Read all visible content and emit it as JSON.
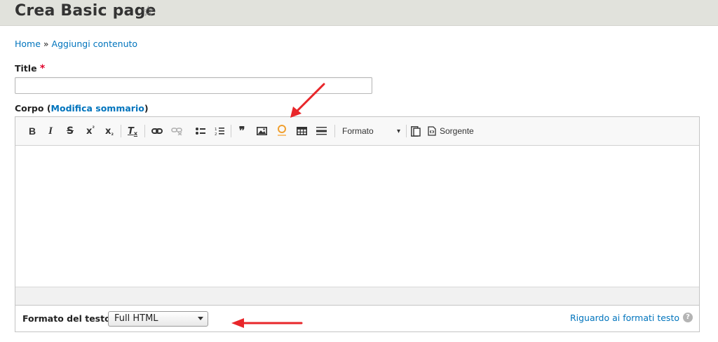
{
  "header": {
    "title": "Crea Basic page",
    "star_icon": "☆"
  },
  "breadcrumb": {
    "home": "Home",
    "separator": " » ",
    "current": "Aggiungi contenuto"
  },
  "title_field": {
    "label": "Title",
    "required_mark": "*",
    "value": ""
  },
  "body_field": {
    "label": "Corpo",
    "paren_open": " (",
    "summary_link": "Modifica sommario",
    "paren_close": ")"
  },
  "toolbar": {
    "bold": "B",
    "italic": "I",
    "strike": "S",
    "superscript": "x",
    "superscript_mark": "²",
    "subscript": "x",
    "subscript_mark": "₂",
    "remove_format": "T",
    "remove_format_mark": "x",
    "blockquote": "❞",
    "format_label": "Formato",
    "format_arrow": "▾",
    "source_label": "Sorgente"
  },
  "text_format": {
    "label": "Formato del testo",
    "selected": "Full HTML",
    "help_link": "Riguardo ai formati testo",
    "help_icon": "?"
  },
  "colors": {
    "link": "#0074bd",
    "header_bg": "#e1e2dc",
    "annotation_arrow": "#e8262a",
    "icon_accent": "#f0a030"
  }
}
